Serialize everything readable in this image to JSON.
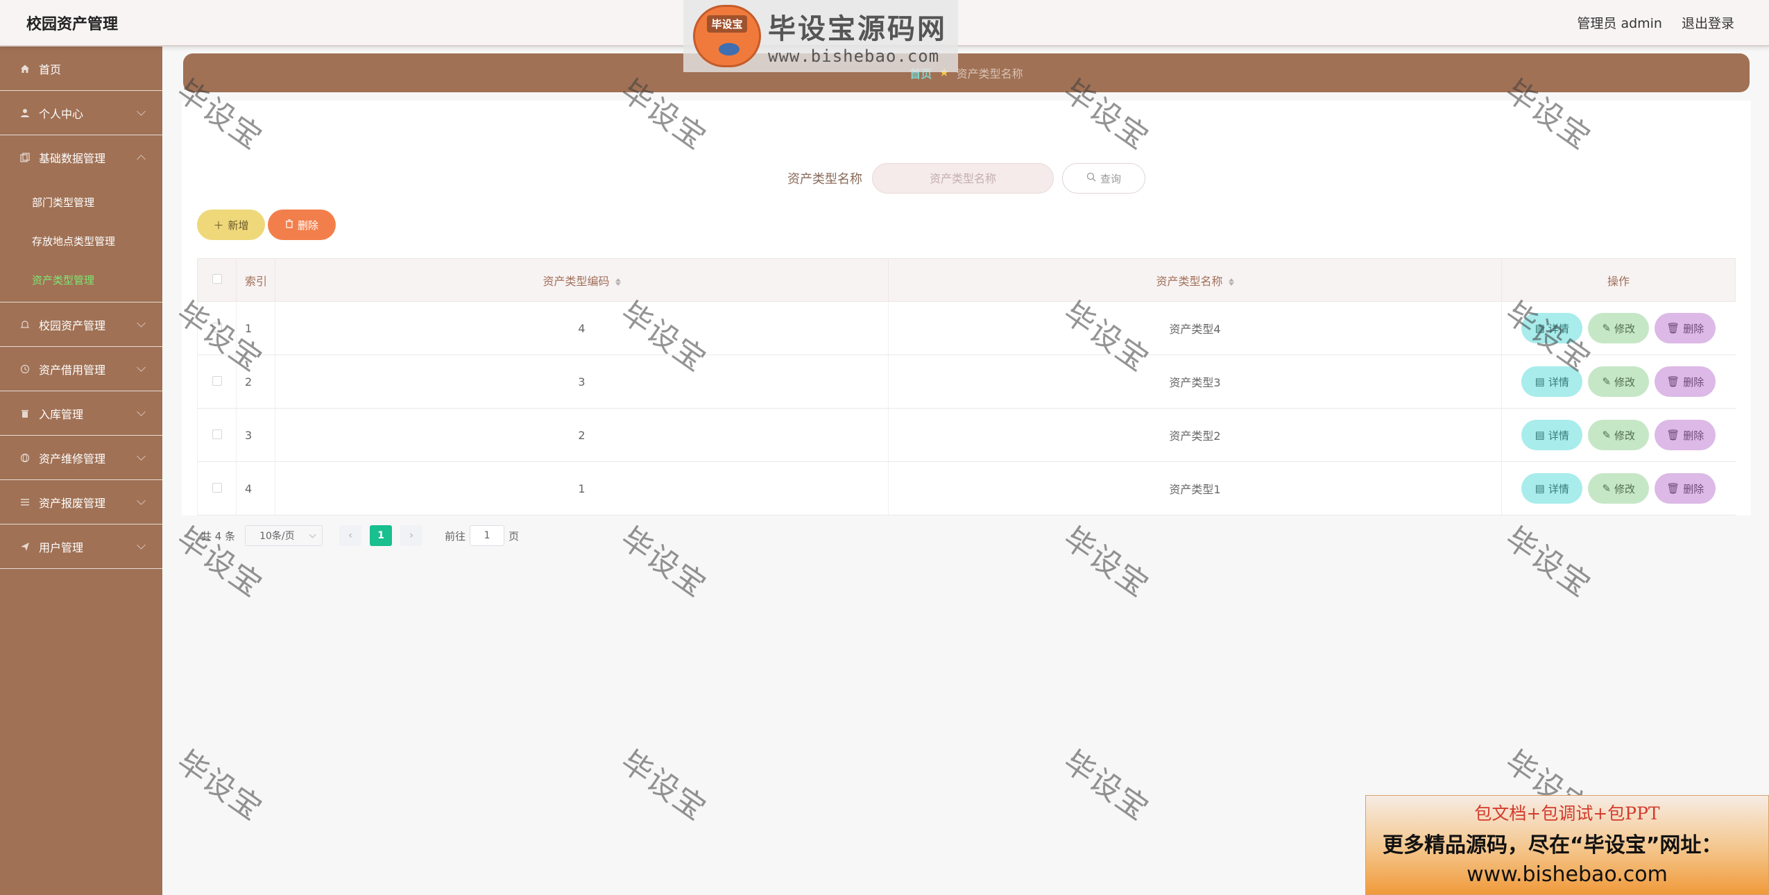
{
  "header": {
    "title": "校园资产管理",
    "user": "管理员 admin",
    "logout": "退出登录"
  },
  "sidebar": {
    "items": [
      {
        "label": "首页",
        "icon": "home-icon"
      },
      {
        "label": "个人中心",
        "icon": "user-icon"
      },
      {
        "label": "基础数据管理",
        "icon": "copy-icon",
        "expanded": true,
        "children": [
          "部门类型管理",
          "存放地点类型管理",
          "资产类型管理"
        ],
        "active_child": 2
      },
      {
        "label": "校园资产管理",
        "icon": "bell-icon"
      },
      {
        "label": "资产借用管理",
        "icon": "clock-icon"
      },
      {
        "label": "入库管理",
        "icon": "trash-icon"
      },
      {
        "label": "资产维修管理",
        "icon": "globe-icon"
      },
      {
        "label": "资产报废管理",
        "icon": "list-icon"
      },
      {
        "label": "用户管理",
        "icon": "send-icon"
      }
    ]
  },
  "breadcrumb": {
    "home": "首页",
    "current": "资产类型名称"
  },
  "search": {
    "label": "资产类型名称",
    "placeholder": "资产类型名称",
    "button": "查询"
  },
  "actions": {
    "add": "新增",
    "delete": "删除"
  },
  "table": {
    "headers": {
      "index": "索引",
      "code": "资产类型编码",
      "name": "资产类型名称",
      "ops": "操作"
    },
    "rows": [
      {
        "index": "1",
        "code": "4",
        "name": "资产类型4"
      },
      {
        "index": "2",
        "code": "3",
        "name": "资产类型3"
      },
      {
        "index": "3",
        "code": "2",
        "name": "资产类型2"
      },
      {
        "index": "4",
        "code": "1",
        "name": "资产类型1"
      }
    ],
    "row_actions": {
      "detail": "详情",
      "edit": "修改",
      "delete": "删除"
    }
  },
  "pagination": {
    "total": "共 4 条",
    "page_size": "10条/页",
    "current": "1",
    "goto_prefix": "前往",
    "goto_value": "1",
    "goto_suffix": "页"
  },
  "watermark": {
    "text": "毕设宝",
    "logo_badge": "毕设宝",
    "logo_main": "毕设宝源码网",
    "logo_url": "www.bishebao.com",
    "promo_line1": "包文档+包调试+包PPT",
    "promo_line2": "更多精品源码，尽在“毕设宝”网址：",
    "promo_line3": "www.bishebao.com"
  },
  "colors": {
    "sidebar_bg": "#a07155",
    "active_menu": "#7ee873",
    "add_button": "#efd87a",
    "delete_button": "#f27f4b",
    "detail_button": "#a8ecec",
    "edit_button": "#c6e7c6",
    "row_delete_button": "#dcb9e6",
    "current_page": "#19bf8e"
  }
}
